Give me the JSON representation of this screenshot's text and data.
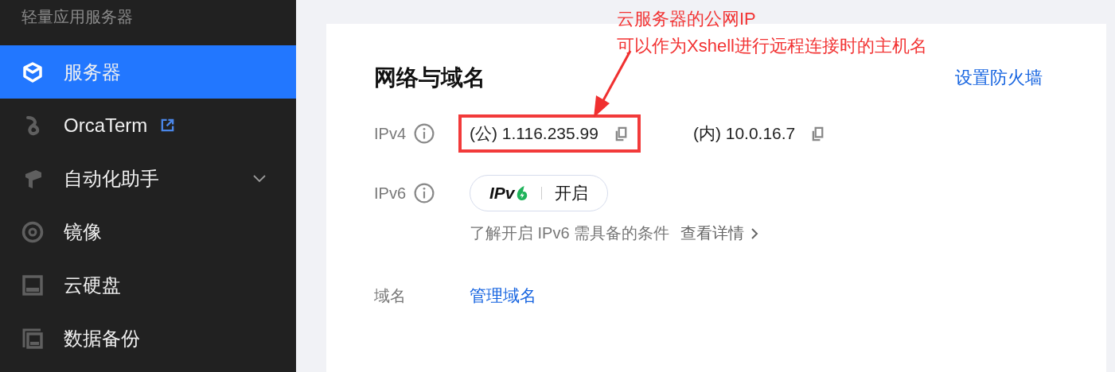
{
  "sidebar": {
    "title": "轻量应用服务器",
    "items": [
      {
        "label": "服务器",
        "selected": true,
        "kind": "plain"
      },
      {
        "label": "OrcaTerm",
        "selected": false,
        "kind": "external"
      },
      {
        "label": "自动化助手",
        "selected": false,
        "kind": "expandable",
        "expanded": false
      },
      {
        "label": "镜像",
        "selected": false,
        "kind": "plain"
      },
      {
        "label": "云硬盘",
        "selected": false,
        "kind": "plain"
      },
      {
        "label": "数据备份",
        "selected": false,
        "kind": "plain"
      }
    ]
  },
  "card": {
    "title": "网络与域名",
    "action": "设置防火墙",
    "rows": [
      {
        "kind": "ipv4",
        "label": "IPv4",
        "addresses": [
          {
            "text": "(公) 1.116.235.99",
            "highlighted": true
          },
          {
            "text": "(内) 10.0.16.7",
            "highlighted": false
          }
        ]
      },
      {
        "kind": "ipv6",
        "label": "IPv6",
        "badge": {
          "logo": "IPv",
          "status": "开启"
        },
        "hint": "了解开启 IPv6 需具备的条件",
        "link": "查看详情"
      },
      {
        "kind": "domain",
        "label": "域名",
        "link": "管理域名"
      }
    ]
  },
  "annotation": {
    "lines": [
      "云服务器的公网IP",
      "可以作为Xshell进行远程连接时的主机名"
    ]
  }
}
